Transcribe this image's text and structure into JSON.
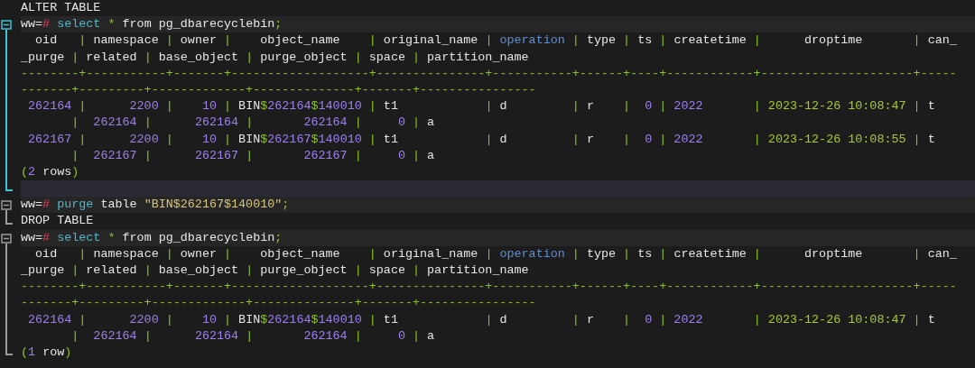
{
  "terminal": {
    "blocks": [
      {
        "kind": "plain",
        "lines": [
          {
            "kind": "output",
            "tokens": [
              {
                "kind": "plain",
                "text": "ALTER TABLE"
              }
            ]
          }
        ]
      },
      {
        "kind": "fold",
        "active": true,
        "lines": [
          {
            "kind": "command",
            "tokens": [
              {
                "kind": "plain",
                "text": "ww="
              },
              {
                "kind": "prompt",
                "text": "#"
              },
              {
                "kind": "keyword",
                "text": " select"
              },
              {
                "kind": "punct",
                "text": " *"
              },
              {
                "kind": "plain",
                "text": " from pg_dbarecyclebin"
              },
              {
                "kind": "punct",
                "text": ";"
              }
            ]
          },
          {
            "kind": "output",
            "tokens": [
              {
                "kind": "plain",
                "text": "  oid   "
              },
              {
                "kind": "punct",
                "text": "|"
              },
              {
                "kind": "plain",
                "text": " namespace "
              },
              {
                "kind": "punct",
                "text": "|"
              },
              {
                "kind": "plain",
                "text": " owner "
              },
              {
                "kind": "punct",
                "text": "|"
              },
              {
                "kind": "plain",
                "text": "    object_name    "
              },
              {
                "kind": "punct",
                "text": "|"
              },
              {
                "kind": "plain",
                "text": " original_name "
              },
              {
                "kind": "punct",
                "text": "|"
              },
              {
                "kind": "column",
                "text": " operation "
              },
              {
                "kind": "punct",
                "text": "|"
              },
              {
                "kind": "plain",
                "text": " type "
              },
              {
                "kind": "punct",
                "text": "|"
              },
              {
                "kind": "plain",
                "text": " ts "
              },
              {
                "kind": "punct",
                "text": "|"
              },
              {
                "kind": "plain",
                "text": " createtime "
              },
              {
                "kind": "punct",
                "text": "|"
              },
              {
                "kind": "plain",
                "text": "      droptime       "
              },
              {
                "kind": "punct",
                "text": "|"
              },
              {
                "kind": "plain",
                "text": " can_"
              }
            ]
          },
          {
            "kind": "output",
            "tokens": [
              {
                "kind": "plain",
                "text": "_purge "
              },
              {
                "kind": "punct",
                "text": "|"
              },
              {
                "kind": "plain",
                "text": " related "
              },
              {
                "kind": "punct",
                "text": "|"
              },
              {
                "kind": "plain",
                "text": " base_object "
              },
              {
                "kind": "punct",
                "text": "|"
              },
              {
                "kind": "plain",
                "text": " purge_object "
              },
              {
                "kind": "punct",
                "text": "|"
              },
              {
                "kind": "plain",
                "text": " space "
              },
              {
                "kind": "punct",
                "text": "|"
              },
              {
                "kind": "plain",
                "text": " partition_name"
              }
            ]
          },
          {
            "kind": "output",
            "tokens": [
              {
                "kind": "punct",
                "text": "--------+-----------+-------+-------------------+---------------+-----------+------+----+------------+---------------------+-----"
              }
            ]
          },
          {
            "kind": "output",
            "tokens": [
              {
                "kind": "punct",
                "text": "-------+---------+-------------+--------------+-------+----------------"
              }
            ]
          },
          {
            "kind": "output",
            "tokens": [
              {
                "kind": "number",
                "text": " 262164"
              },
              {
                "kind": "punct",
                "text": " |"
              },
              {
                "kind": "number",
                "text": "      2200"
              },
              {
                "kind": "punct",
                "text": " |"
              },
              {
                "kind": "number",
                "text": "    10"
              },
              {
                "kind": "punct",
                "text": " |"
              },
              {
                "kind": "plain",
                "text": " BIN"
              },
              {
                "kind": "punct",
                "text": "$"
              },
              {
                "kind": "number",
                "text": "262164"
              },
              {
                "kind": "punct",
                "text": "$"
              },
              {
                "kind": "number",
                "text": "140010"
              },
              {
                "kind": "punct",
                "text": " |"
              },
              {
                "kind": "plain",
                "text": " t1            "
              },
              {
                "kind": "punct",
                "text": "|"
              },
              {
                "kind": "plain",
                "text": " d         "
              },
              {
                "kind": "punct",
                "text": "|"
              },
              {
                "kind": "plain",
                "text": " r    "
              },
              {
                "kind": "punct",
                "text": "|"
              },
              {
                "kind": "number",
                "text": "  0"
              },
              {
                "kind": "punct",
                "text": " |"
              },
              {
                "kind": "number",
                "text": " 2022"
              },
              {
                "kind": "punct",
                "text": "       |"
              },
              {
                "kind": "date",
                "text": " 2023-12-26 10:08:47"
              },
              {
                "kind": "punct",
                "text": " |"
              },
              {
                "kind": "plain",
                "text": " t"
              }
            ]
          },
          {
            "kind": "output",
            "tokens": [
              {
                "kind": "punct",
                "text": "       |"
              },
              {
                "kind": "number",
                "text": "  262164"
              },
              {
                "kind": "punct",
                "text": " |"
              },
              {
                "kind": "number",
                "text": "      262164"
              },
              {
                "kind": "punct",
                "text": " |"
              },
              {
                "kind": "number",
                "text": "       262164"
              },
              {
                "kind": "punct",
                "text": " |"
              },
              {
                "kind": "number",
                "text": "     0"
              },
              {
                "kind": "punct",
                "text": " |"
              },
              {
                "kind": "plain",
                "text": " a"
              }
            ]
          },
          {
            "kind": "output",
            "tokens": [
              {
                "kind": "number",
                "text": " 262167"
              },
              {
                "kind": "punct",
                "text": " |"
              },
              {
                "kind": "number",
                "text": "      2200"
              },
              {
                "kind": "punct",
                "text": " |"
              },
              {
                "kind": "number",
                "text": "    10"
              },
              {
                "kind": "punct",
                "text": " |"
              },
              {
                "kind": "plain",
                "text": " BIN"
              },
              {
                "kind": "punct",
                "text": "$"
              },
              {
                "kind": "number",
                "text": "262167"
              },
              {
                "kind": "punct",
                "text": "$"
              },
              {
                "kind": "number",
                "text": "140010"
              },
              {
                "kind": "punct",
                "text": " |"
              },
              {
                "kind": "plain",
                "text": " t1            "
              },
              {
                "kind": "punct",
                "text": "|"
              },
              {
                "kind": "plain",
                "text": " d         "
              },
              {
                "kind": "punct",
                "text": "|"
              },
              {
                "kind": "plain",
                "text": " r    "
              },
              {
                "kind": "punct",
                "text": "|"
              },
              {
                "kind": "number",
                "text": "  0"
              },
              {
                "kind": "punct",
                "text": " |"
              },
              {
                "kind": "number",
                "text": " 2022"
              },
              {
                "kind": "punct",
                "text": "       |"
              },
              {
                "kind": "date",
                "text": " 2023-12-26 10:08:55"
              },
              {
                "kind": "punct",
                "text": " |"
              },
              {
                "kind": "plain",
                "text": " t"
              }
            ]
          },
          {
            "kind": "output",
            "tokens": [
              {
                "kind": "punct",
                "text": "       |"
              },
              {
                "kind": "number",
                "text": "  262167"
              },
              {
                "kind": "punct",
                "text": " |"
              },
              {
                "kind": "number",
                "text": "      262167"
              },
              {
                "kind": "punct",
                "text": " |"
              },
              {
                "kind": "number",
                "text": "       262167"
              },
              {
                "kind": "punct",
                "text": " |"
              },
              {
                "kind": "number",
                "text": "     0"
              },
              {
                "kind": "punct",
                "text": " |"
              },
              {
                "kind": "plain",
                "text": " a"
              }
            ]
          },
          {
            "kind": "output",
            "tokens": [
              {
                "kind": "punct",
                "text": "("
              },
              {
                "kind": "number",
                "text": "2"
              },
              {
                "kind": "plain",
                "text": " rows"
              },
              {
                "kind": "punct",
                "text": ")"
              }
            ]
          },
          {
            "kind": "blank"
          }
        ]
      },
      {
        "kind": "fold",
        "active": false,
        "lines": [
          {
            "kind": "command",
            "tokens": [
              {
                "kind": "plain",
                "text": "ww="
              },
              {
                "kind": "prompt",
                "text": "#"
              },
              {
                "kind": "keyword",
                "text": " purge"
              },
              {
                "kind": "plain",
                "text": " table "
              },
              {
                "kind": "string",
                "text": "\"BIN$262167$140010\""
              },
              {
                "kind": "punct",
                "text": ";"
              }
            ]
          },
          {
            "kind": "output",
            "tokens": [
              {
                "kind": "plain",
                "text": "DROP TABLE"
              }
            ]
          }
        ]
      },
      {
        "kind": "fold",
        "active": false,
        "lines": [
          {
            "kind": "command",
            "tokens": [
              {
                "kind": "plain",
                "text": "ww="
              },
              {
                "kind": "prompt",
                "text": "#"
              },
              {
                "kind": "keyword",
                "text": " select"
              },
              {
                "kind": "punct",
                "text": " *"
              },
              {
                "kind": "plain",
                "text": " from pg_dbarecyclebin"
              },
              {
                "kind": "punct",
                "text": ";"
              }
            ]
          },
          {
            "kind": "output",
            "tokens": [
              {
                "kind": "plain",
                "text": "  oid   "
              },
              {
                "kind": "punct",
                "text": "|"
              },
              {
                "kind": "plain",
                "text": " namespace "
              },
              {
                "kind": "punct",
                "text": "|"
              },
              {
                "kind": "plain",
                "text": " owner "
              },
              {
                "kind": "punct",
                "text": "|"
              },
              {
                "kind": "plain",
                "text": "    object_name    "
              },
              {
                "kind": "punct",
                "text": "|"
              },
              {
                "kind": "plain",
                "text": " original_name "
              },
              {
                "kind": "punct",
                "text": "|"
              },
              {
                "kind": "column",
                "text": " operation "
              },
              {
                "kind": "punct",
                "text": "|"
              },
              {
                "kind": "plain",
                "text": " type "
              },
              {
                "kind": "punct",
                "text": "|"
              },
              {
                "kind": "plain",
                "text": " ts "
              },
              {
                "kind": "punct",
                "text": "|"
              },
              {
                "kind": "plain",
                "text": " createtime "
              },
              {
                "kind": "punct",
                "text": "|"
              },
              {
                "kind": "plain",
                "text": "      droptime       "
              },
              {
                "kind": "punct",
                "text": "|"
              },
              {
                "kind": "plain",
                "text": " can_"
              }
            ]
          },
          {
            "kind": "output",
            "tokens": [
              {
                "kind": "plain",
                "text": "_purge "
              },
              {
                "kind": "punct",
                "text": "|"
              },
              {
                "kind": "plain",
                "text": " related "
              },
              {
                "kind": "punct",
                "text": "|"
              },
              {
                "kind": "plain",
                "text": " base_object "
              },
              {
                "kind": "punct",
                "text": "|"
              },
              {
                "kind": "plain",
                "text": " purge_object "
              },
              {
                "kind": "punct",
                "text": "|"
              },
              {
                "kind": "plain",
                "text": " space "
              },
              {
                "kind": "punct",
                "text": "|"
              },
              {
                "kind": "plain",
                "text": " partition_name"
              }
            ]
          },
          {
            "kind": "output",
            "tokens": [
              {
                "kind": "punct",
                "text": "--------+-----------+-------+-------------------+---------------+-----------+------+----+------------+---------------------+-----"
              }
            ]
          },
          {
            "kind": "output",
            "tokens": [
              {
                "kind": "punct",
                "text": "-------+---------+-------------+--------------+-------+----------------"
              }
            ]
          },
          {
            "kind": "output",
            "tokens": [
              {
                "kind": "number",
                "text": " 262164"
              },
              {
                "kind": "punct",
                "text": " |"
              },
              {
                "kind": "number",
                "text": "      2200"
              },
              {
                "kind": "punct",
                "text": " |"
              },
              {
                "kind": "number",
                "text": "    10"
              },
              {
                "kind": "punct",
                "text": " |"
              },
              {
                "kind": "plain",
                "text": " BIN"
              },
              {
                "kind": "punct",
                "text": "$"
              },
              {
                "kind": "number",
                "text": "262164"
              },
              {
                "kind": "punct",
                "text": "$"
              },
              {
                "kind": "number",
                "text": "140010"
              },
              {
                "kind": "punct",
                "text": " |"
              },
              {
                "kind": "plain",
                "text": " t1            "
              },
              {
                "kind": "punct",
                "text": "|"
              },
              {
                "kind": "plain",
                "text": " d         "
              },
              {
                "kind": "punct",
                "text": "|"
              },
              {
                "kind": "plain",
                "text": " r    "
              },
              {
                "kind": "punct",
                "text": "|"
              },
              {
                "kind": "number",
                "text": "  0"
              },
              {
                "kind": "punct",
                "text": " |"
              },
              {
                "kind": "number",
                "text": " 2022"
              },
              {
                "kind": "punct",
                "text": "       |"
              },
              {
                "kind": "date",
                "text": " 2023-12-26 10:08:47"
              },
              {
                "kind": "punct",
                "text": " |"
              },
              {
                "kind": "plain",
                "text": " t"
              }
            ]
          },
          {
            "kind": "output",
            "tokens": [
              {
                "kind": "punct",
                "text": "       |"
              },
              {
                "kind": "number",
                "text": "  262164"
              },
              {
                "kind": "punct",
                "text": " |"
              },
              {
                "kind": "number",
                "text": "      262164"
              },
              {
                "kind": "punct",
                "text": " |"
              },
              {
                "kind": "number",
                "text": "       262164"
              },
              {
                "kind": "punct",
                "text": " |"
              },
              {
                "kind": "number",
                "text": "     0"
              },
              {
                "kind": "punct",
                "text": " |"
              },
              {
                "kind": "plain",
                "text": " a"
              }
            ]
          },
          {
            "kind": "output",
            "tokens": [
              {
                "kind": "punct",
                "text": "("
              },
              {
                "kind": "number",
                "text": "1"
              },
              {
                "kind": "plain",
                "text": " row"
              },
              {
                "kind": "punct",
                "text": ")"
              }
            ]
          }
        ]
      }
    ]
  }
}
